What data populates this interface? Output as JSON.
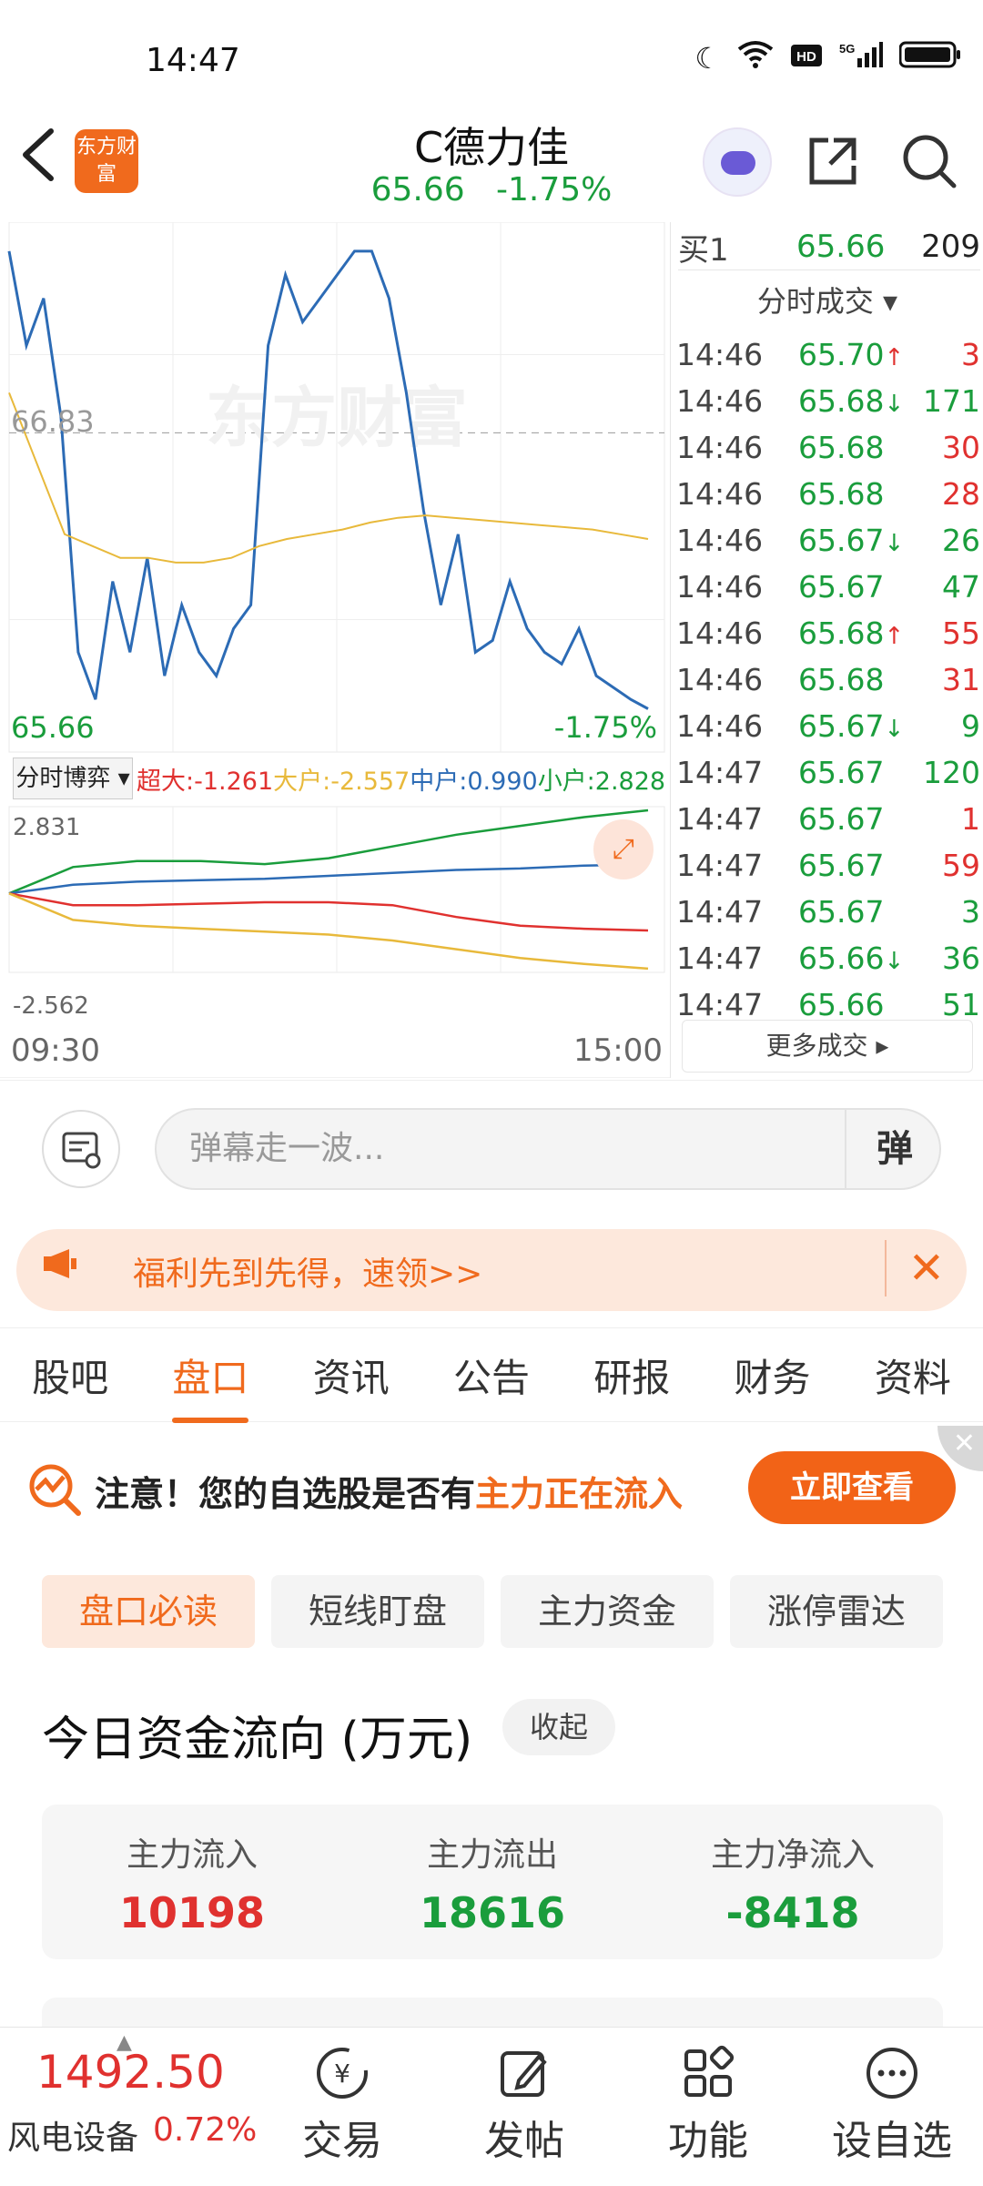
{
  "status_bar": {
    "time": "14:47"
  },
  "header": {
    "back_icon": "‹",
    "logo_text": "东方财富",
    "title": "C德力佳",
    "price": "65.66",
    "change": "-1.75%"
  },
  "chart": {
    "ref_price_label": "66.83",
    "low_label": "65.66",
    "pct_label": "-1.75%",
    "watermark": "东方财富",
    "flow_tab": "分时博弈 ▾",
    "flow_legend": {
      "super": "超大:-1.261",
      "large": "大户:-2.557",
      "medium": "中户:0.990",
      "small": "小户:2.828"
    },
    "flow_max": "2.831",
    "flow_min": "-2.562",
    "time_start": "09:30",
    "time_end": "15:00"
  },
  "chart_data": [
    {
      "type": "line",
      "title": "",
      "series": [
        {
          "values": [
            67.6,
            67.2,
            67.4,
            66.9,
            65.9,
            65.7,
            66.2,
            65.9,
            66.3,
            65.8,
            66.1,
            65.9,
            65.8,
            66.0,
            66.1,
            67.2,
            67.5,
            67.3,
            67.4,
            67.5,
            67.6,
            67.6,
            67.4,
            67.0,
            66.5,
            66.1,
            66.4,
            65.9,
            65.95,
            66.2,
            66.0,
            65.9,
            65.85,
            66.0,
            65.8,
            65.75,
            65.7,
            65.66
          ]
        },
        {
          "values": [
            67.0,
            66.7,
            66.4,
            66.35,
            66.3,
            66.3,
            66.28,
            66.28,
            66.3,
            66.35,
            66.38,
            66.4,
            66.42,
            66.45,
            66.47,
            66.48,
            66.47,
            66.46,
            66.45,
            66.44,
            66.43,
            66.42,
            66.4,
            66.38
          ]
        }
      ],
      "ylim": [
        65.5,
        67.7
      ]
    },
    {
      "type": "line",
      "title": "",
      "series": [
        {
          "values": [
            0,
            0.9,
            1.1,
            1.1,
            1.0,
            1.2,
            1.6,
            2.0,
            2.3,
            2.6,
            2.83
          ]
        },
        {
          "values": [
            0,
            0.3,
            0.4,
            0.45,
            0.5,
            0.6,
            0.7,
            0.8,
            0.85,
            0.95,
            0.99
          ]
        },
        {
          "values": [
            0,
            -0.4,
            -0.4,
            -0.35,
            -0.3,
            -0.3,
            -0.4,
            -0.8,
            -1.1,
            -1.2,
            -1.26
          ]
        },
        {
          "values": [
            0,
            -0.9,
            -1.1,
            -1.2,
            -1.3,
            -1.4,
            -1.6,
            -1.9,
            -2.2,
            -2.4,
            -2.56
          ]
        }
      ],
      "ylim": [
        -2.562,
        2.831
      ]
    }
  ],
  "right_panel": {
    "buy1_label": "买1",
    "buy1_price": "65.66",
    "buy1_vol": "209",
    "trades_title": "分时成交 ▾",
    "trades": [
      {
        "time": "14:46",
        "price": "65.70",
        "dir": "↑",
        "vol": "3",
        "color": "#e0312f"
      },
      {
        "time": "14:46",
        "price": "65.68",
        "dir": "↓",
        "vol": "171",
        "color": "#1a9d3c"
      },
      {
        "time": "14:46",
        "price": "65.68",
        "dir": "",
        "vol": "30",
        "color": "#e0312f"
      },
      {
        "time": "14:46",
        "price": "65.68",
        "dir": "",
        "vol": "28",
        "color": "#e0312f"
      },
      {
        "time": "14:46",
        "price": "65.67",
        "dir": "↓",
        "vol": "26",
        "color": "#1a9d3c"
      },
      {
        "time": "14:46",
        "price": "65.67",
        "dir": "",
        "vol": "47",
        "color": "#1a9d3c"
      },
      {
        "time": "14:46",
        "price": "65.68",
        "dir": "↑",
        "vol": "55",
        "color": "#e0312f"
      },
      {
        "time": "14:46",
        "price": "65.68",
        "dir": "",
        "vol": "31",
        "color": "#e0312f"
      },
      {
        "time": "14:46",
        "price": "65.67",
        "dir": "↓",
        "vol": "9",
        "color": "#1a9d3c"
      },
      {
        "time": "14:47",
        "price": "65.67",
        "dir": "",
        "vol": "120",
        "color": "#1a9d3c"
      },
      {
        "time": "14:47",
        "price": "65.67",
        "dir": "",
        "vol": "1",
        "color": "#e0312f"
      },
      {
        "time": "14:47",
        "price": "65.67",
        "dir": "",
        "vol": "59",
        "color": "#e0312f"
      },
      {
        "time": "14:47",
        "price": "65.67",
        "dir": "",
        "vol": "3",
        "color": "#1a9d3c"
      },
      {
        "time": "14:47",
        "price": "65.66",
        "dir": "↓",
        "vol": "36",
        "color": "#1a9d3c"
      },
      {
        "time": "14:47",
        "price": "65.66",
        "dir": "",
        "vol": "51",
        "color": "#1a9d3c"
      }
    ],
    "more_trades": "更多成交 ▸"
  },
  "danmu": {
    "placeholder": "弹幕走一波...",
    "send_label": "弹"
  },
  "promo": {
    "text": "福利先到先得，速领>>"
  },
  "tabs": [
    "股吧",
    "盘口",
    "资讯",
    "公告",
    "研报",
    "财务",
    "资料"
  ],
  "notice": {
    "prefix": "注意！您的自选股是否有",
    "highlight": "主力正在流入",
    "button": "立即查看"
  },
  "subtabs": [
    "盘口必读",
    "短线盯盘",
    "主力资金",
    "涨停雷达"
  ],
  "fund": {
    "title": "今日资金流向 (万元)",
    "collapse": "收起",
    "inflow_label": "主力流入",
    "inflow_value": "10198",
    "outflow_label": "主力流出",
    "outflow_value": "18616",
    "net_label": "主力净流入",
    "net_value": "-8418"
  },
  "bottom": {
    "index_value": "1492.50",
    "index_name": "风电设备",
    "index_change": "0.72%",
    "nav": [
      "交易",
      "发帖",
      "功能",
      "设自选"
    ]
  },
  "colors": {
    "up": "#e0312f",
    "down": "#1a9d3c",
    "accent": "#f06a1d",
    "price_line": "#2c6bb5",
    "avg_line": "#e8b93b"
  }
}
